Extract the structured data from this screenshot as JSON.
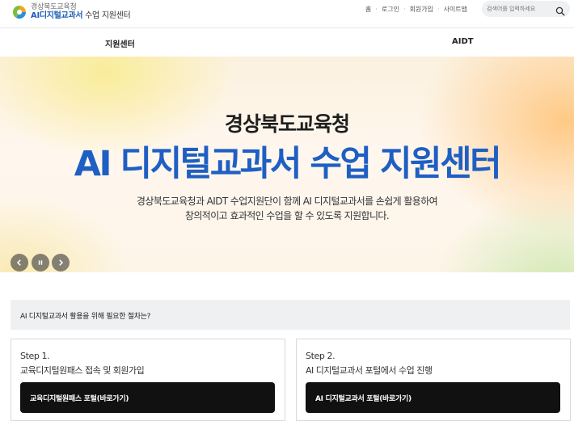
{
  "header": {
    "logo_line1": "경상북도교육청",
    "logo_line2_accent": "AI디지털교과서",
    "logo_line2_rest": " 수업 지원센터",
    "utility_links": [
      "홈",
      "로그인",
      "회원가입",
      "사이트맵"
    ],
    "search_placeholder": "검색어를 입력하세요"
  },
  "nav": {
    "items": [
      "지원센터",
      "AIDT"
    ]
  },
  "hero": {
    "org": "경상북도교육청",
    "title": "AI 디지털교과서 수업 지원센터",
    "desc_line1": "경상북도교육청과 AIDT 수업지원단이 함께 AI 디지털교과서를 손쉽게 활용하여",
    "desc_line2": "창의적이고 효과적인 수업을 할 수 있도록 지원합니다.",
    "controls": [
      "prev-icon",
      "pause-icon",
      "next-icon"
    ]
  },
  "question": {
    "text": "AI 디지털교과서 활용을 위해 필요한 절차는?"
  },
  "steps": [
    {
      "step": "Step 1.",
      "desc": "교육디지털원패스 접속 및 회원가입",
      "button": "교육디지털원패스 포털(바로가기)"
    },
    {
      "step": "Step 2.",
      "desc": "AI 디지털교과서 포털에서 수업 진행",
      "button": "AI 디지털교과서 포털(바로가기)"
    }
  ],
  "colors": {
    "accent": "#1f5fc4",
    "button": "#111111",
    "question_bg": "#eff0f2"
  }
}
